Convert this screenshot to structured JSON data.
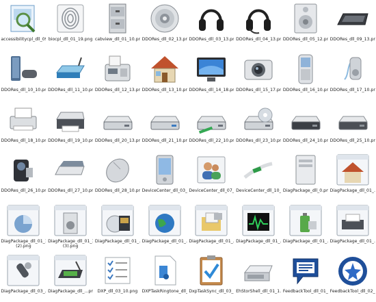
{
  "rows": [
    [
      {
        "label": "accessibilitycpl_dll_09_...",
        "icon": "magnifier-document-icon"
      },
      {
        "label": "biocpl_dll_01_19.png",
        "icon": "fingerprint-icon"
      },
      {
        "label": "cabview_dll_01_10.png",
        "icon": "cabinet-file-icon"
      },
      {
        "label": "DDORes_dll_02_13.png",
        "icon": "speaker-icon"
      },
      {
        "label": "DDORes_dll_03_13.png",
        "icon": "headphones-icon"
      },
      {
        "label": "DDORes_dll_04_13.png",
        "icon": "headset-icon"
      },
      {
        "label": "DDORes_dll_05_12.png",
        "icon": "speaker-box-icon"
      },
      {
        "label": "DDORes_dll_09_13.png",
        "icon": "keyboard-icon"
      }
    ],
    [
      {
        "label": "DDORes_dll_10_10.png",
        "icon": "game-console-icon"
      },
      {
        "label": "DDORes_dll_11_10.png",
        "icon": "router-icon"
      },
      {
        "label": "DDORes_dll_12_13.png",
        "icon": "fax-phone-icon"
      },
      {
        "label": "DDORes_dll_13_10.png",
        "icon": "house-icon"
      },
      {
        "label": "DDORes_dll_14_18.png",
        "icon": "monitor-icon"
      },
      {
        "label": "DDORes_dll_15_17.png",
        "icon": "camera-icon"
      },
      {
        "label": "DDORes_dll_16_10.png",
        "icon": "mobile-phone-icon"
      },
      {
        "label": "DDORes_dll_17_10.png",
        "icon": "media-player-icon"
      }
    ],
    [
      {
        "label": "DDORes_dll_18_10.png",
        "icon": "printer-icon"
      },
      {
        "label": "DDORes_dll_19_10.png",
        "icon": "printer-large-icon"
      },
      {
        "label": "DDORes_dll_20_13.png",
        "icon": "drive-icon"
      },
      {
        "label": "DDORes_dll_21_10.png",
        "icon": "floppy-drive-icon"
      },
      {
        "label": "DDORes_dll_22_10.png",
        "icon": "network-drive-icon"
      },
      {
        "label": "DDORes_dll_23_10.png",
        "icon": "cd-drive-icon"
      },
      {
        "label": "DDORes_dll_24_10.png",
        "icon": "drive-black-icon"
      },
      {
        "label": "DDORes_dll_25_10.png",
        "icon": "drive-dark-icon"
      }
    ],
    [
      {
        "label": "DDORes_dll_26_10.png",
        "icon": "camcorder-icon"
      },
      {
        "label": "DDORes_dll_27_10.png",
        "icon": "scanner-icon"
      },
      {
        "label": "DDORes_dll_28_10.png",
        "icon": "mouse-icon"
      },
      {
        "label": "DeviceCenter_dll_03_...",
        "icon": "pda-icon"
      },
      {
        "label": "DeviceCenter_dll_07_...",
        "icon": "users-icon"
      },
      {
        "label": "DeviceCenter_dll_10_...",
        "icon": "cable-icon"
      },
      {
        "label": "DiagPackage_dll_0.png",
        "icon": "computer-tower-icon"
      },
      {
        "label": "DiagPackage_dll_01_...",
        "icon": "house-window-icon"
      }
    ],
    [
      {
        "label": "DiagPackage_dll_01_13 (2).png",
        "icon": "pie-chart-window-icon"
      },
      {
        "label": "DiagPackage_dll_01_13 (3).png",
        "icon": "speaker-window-icon"
      },
      {
        "label": "DiagPackage_dll_01_...",
        "icon": "media-window-icon"
      },
      {
        "label": "DiagPackage_dll_01_...",
        "icon": "globe-window-icon"
      },
      {
        "label": "DiagPackage_dll_01_...",
        "icon": "folder-window-icon"
      },
      {
        "label": "DiagPackage_dll_01_...",
        "icon": "monitor-graph-window-icon"
      },
      {
        "label": "DiagPackage_dll_01_...",
        "icon": "battery-window-icon"
      },
      {
        "label": "DiagPackage_dll_01_...",
        "icon": "printer-window-icon"
      }
    ],
    [
      {
        "label": "DiagPackage_dll_03_...",
        "icon": "microphone-window-icon"
      },
      {
        "label": "DiagPackage_dll_...png",
        "icon": "pen-tablet-window-icon"
      },
      {
        "label": "DXP_dll_03_10.png",
        "icon": "checklist-icon"
      },
      {
        "label": "DXPTaskRingtone_dll_...",
        "icon": "music-file-icon"
      },
      {
        "label": "DxpTaskSync_dll_03_...",
        "icon": "clipboard-check-icon"
      },
      {
        "label": "EhStorShell_dll_01_1...",
        "icon": "storage-device-icon"
      },
      {
        "label": "FeedbackTool_dll_01_...",
        "icon": "feedback-bubble-icon"
      },
      {
        "label": "FeedbackTool_dll_02_...",
        "icon": "feedback-circle-icon"
      }
    ]
  ]
}
